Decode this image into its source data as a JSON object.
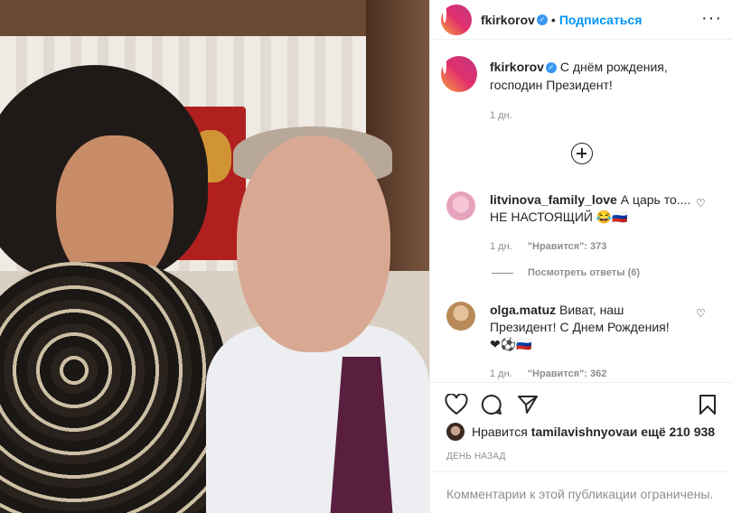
{
  "header": {
    "username": "fkirkorov",
    "separator": "•",
    "follow_label": "Подписаться",
    "more_icon": "more-horizontal-icon"
  },
  "caption": {
    "username": "fkirkorov",
    "text_line1": "С днём рождения,",
    "text_line2": "господин Президент!",
    "time": "1 дн."
  },
  "comments": [
    {
      "username": "litvinova_family_love",
      "text_line1": " А царь то....",
      "text_line2": "НЕ НАСТОЯЩИЙ 😂🇷🇺",
      "time": "1 дн.",
      "likes": "\"Нравится\": 373"
    },
    {
      "username": "olga.matuz",
      "text_line1": " Виват, наш",
      "text_line2": "Президент! С Днем Рождения!",
      "text_line3": "❤⚽🇷🇺",
      "time": "1 дн.",
      "likes": "\"Нравится\": 362"
    }
  ],
  "view_replies": "Посмотреть ответы (6)",
  "likes_row": {
    "prefix": "Нравится ",
    "user": "tamilavishnyova",
    "suffix": " и ещё 210 938"
  },
  "post_time": "ДЕНЬ НАЗАД",
  "comments_limited": "Комментарии к этой публикации ограничены.",
  "colors": {
    "accent": "#0095f6",
    "verified": "#3897f0",
    "muted": "#8e8e8e"
  }
}
